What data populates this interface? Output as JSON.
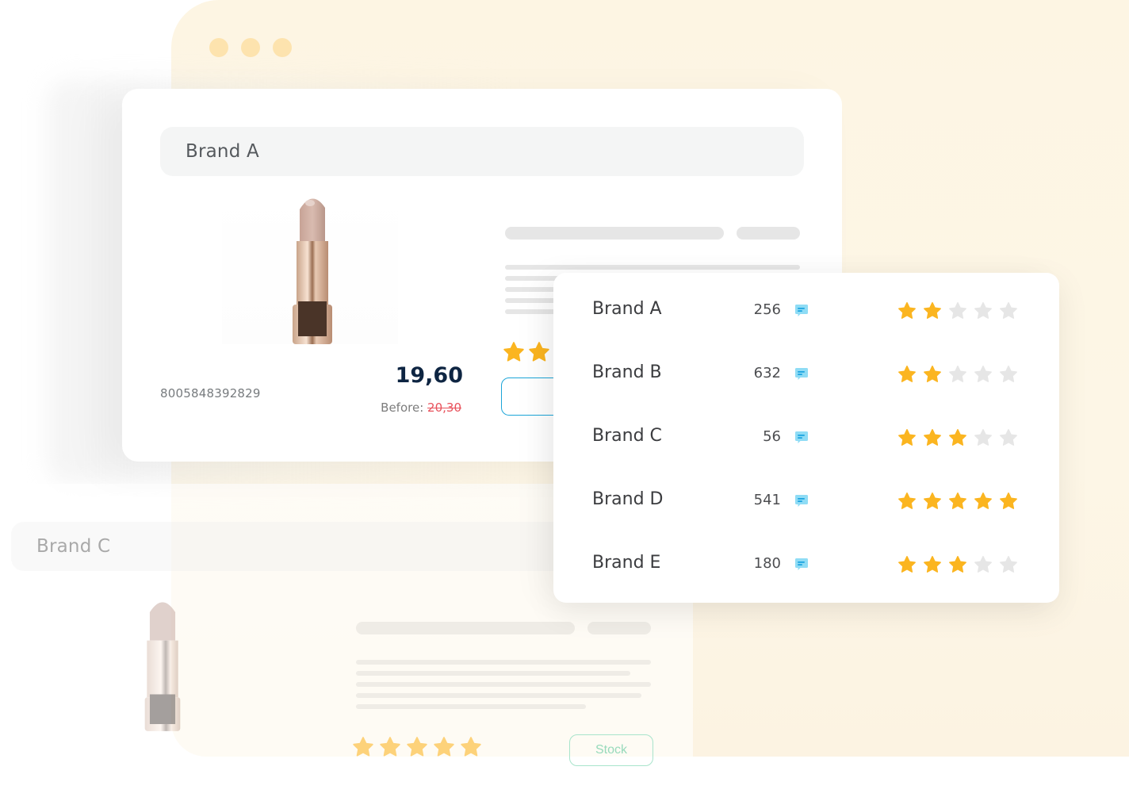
{
  "colors": {
    "accent_star": "#fbb520",
    "empty_star": "#e6e6e6",
    "faded_star": "#fdd27a",
    "price": "#0e2542",
    "strike_price": "#e8525c",
    "outline_button": "#1ca5d8",
    "chat_icon_bg": "#8fdcf5",
    "chat_icon_lines": "#1aa3e0",
    "stock_button": "#a8e4cb",
    "window_bg": "#fdf5e3",
    "window_dots": "#fde3ae"
  },
  "window": {
    "controls": [
      "dot",
      "dot",
      "dot"
    ]
  },
  "product_card": {
    "brand": "Brand A",
    "image": "lipstick-image",
    "barcode": "8005848392829",
    "price": "19,60",
    "before_label": "Before:",
    "before_price": "20,30",
    "rating": 2,
    "rating_max": 2
  },
  "secondary_card": {
    "brand": "Brand C",
    "image": "lipstick-image",
    "rating": 5,
    "rating_max": 5,
    "stock_label": "Stock"
  },
  "brands_panel": {
    "rows": [
      {
        "name": "Brand A",
        "reviews": "256",
        "rating": 2,
        "icon": "chat-icon"
      },
      {
        "name": "Brand B",
        "reviews": "632",
        "rating": 2,
        "icon": "chat-icon"
      },
      {
        "name": "Brand C",
        "reviews": "56",
        "rating": 3,
        "icon": "chat-icon"
      },
      {
        "name": "Brand D",
        "reviews": "541",
        "rating": 5,
        "icon": "chat-icon"
      },
      {
        "name": "Brand E",
        "reviews": "180",
        "rating": 3,
        "icon": "chat-icon"
      }
    ],
    "rating_max": 5
  }
}
